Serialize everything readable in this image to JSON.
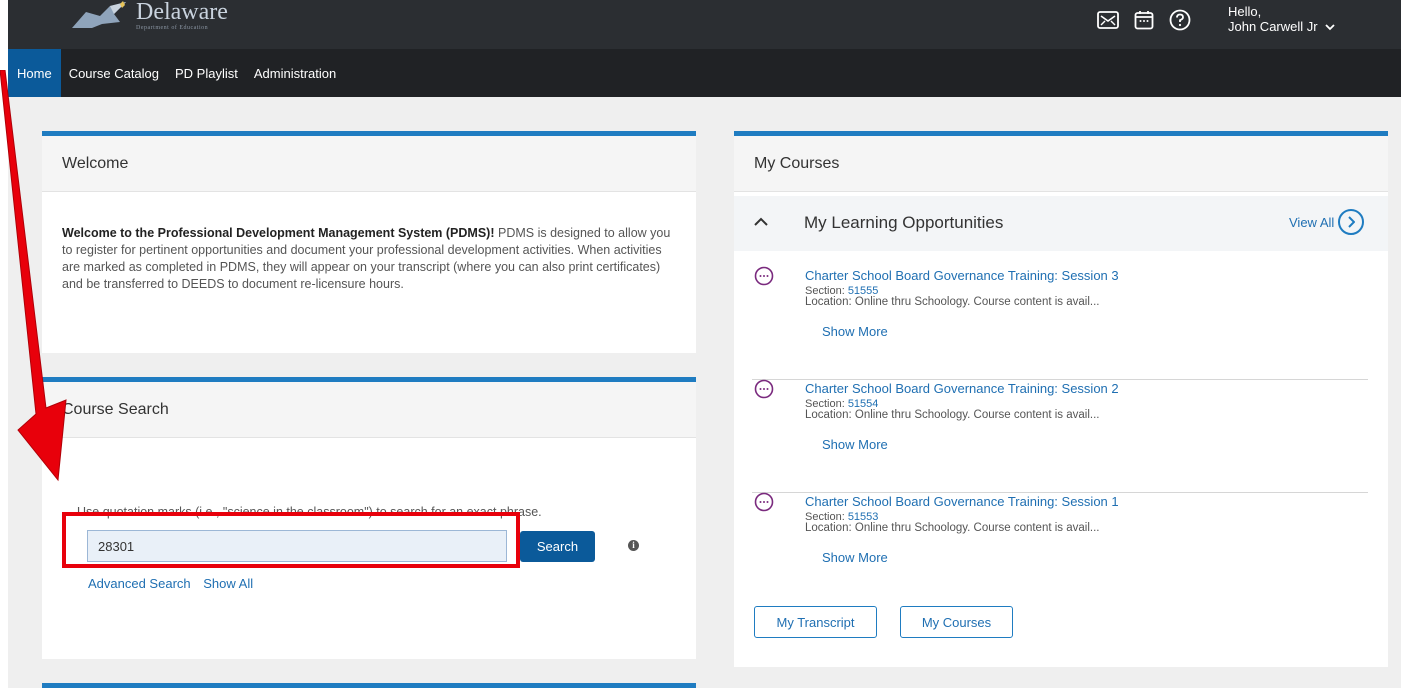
{
  "header": {
    "logo_title": "Delaware",
    "logo_subtitle": "Department of Education",
    "greeting": "Hello,",
    "user_name": "John Carwell Jr"
  },
  "nav": {
    "items": [
      "Home",
      "Course Catalog",
      "PD Playlist",
      "Administration"
    ],
    "active": "Home"
  },
  "welcome": {
    "title": "Welcome",
    "bold_lead": "Welcome to the Professional Development Management System (PDMS)!",
    "body": " PDMS is designed to allow you to register for pertinent opportunities and document your professional development activities. When activities are marked as completed in PDMS, they will appear on your transcript (where you can also print certificates) and be transferred to DEEDS to document re-licensure hours."
  },
  "search": {
    "title": "Course Search",
    "hint": "Use quotation marks (i.e., \"science in the classroom\") to search for an exact phrase.",
    "value": "28301",
    "button": "Search",
    "advanced_link": "Advanced Search",
    "show_all_link": "Show All"
  },
  "my_courses": {
    "title": "My Courses",
    "subtitle": "My Learning Opportunities",
    "view_all": "View All",
    "section_label": "Section:",
    "items": [
      {
        "title": "Charter School Board Governance Training: Session 3",
        "section": "51555",
        "location": "Location: Online thru Schoology. Course content is avail...",
        "more": "Show More"
      },
      {
        "title": "Charter School Board Governance Training: Session 2",
        "section": "51554",
        "location": "Location: Online thru Schoology. Course content is avail...",
        "more": "Show More"
      },
      {
        "title": "Charter School Board Governance Training: Session 1",
        "section": "51553",
        "location": "Location: Online thru Schoology. Course content is avail...",
        "more": "Show More"
      }
    ],
    "transcript_button": "My Transcript",
    "courses_button": "My Courses"
  },
  "colors": {
    "accent": "#1f7cc1",
    "nav_active": "#0b5a9a",
    "annotation": "#e8000b"
  },
  "icons": [
    "mail-icon",
    "calendar-icon",
    "help-icon",
    "chevron-down-icon",
    "info-icon",
    "chevron-up-icon",
    "chevron-right-icon",
    "more-icon",
    "annotation-arrow"
  ]
}
